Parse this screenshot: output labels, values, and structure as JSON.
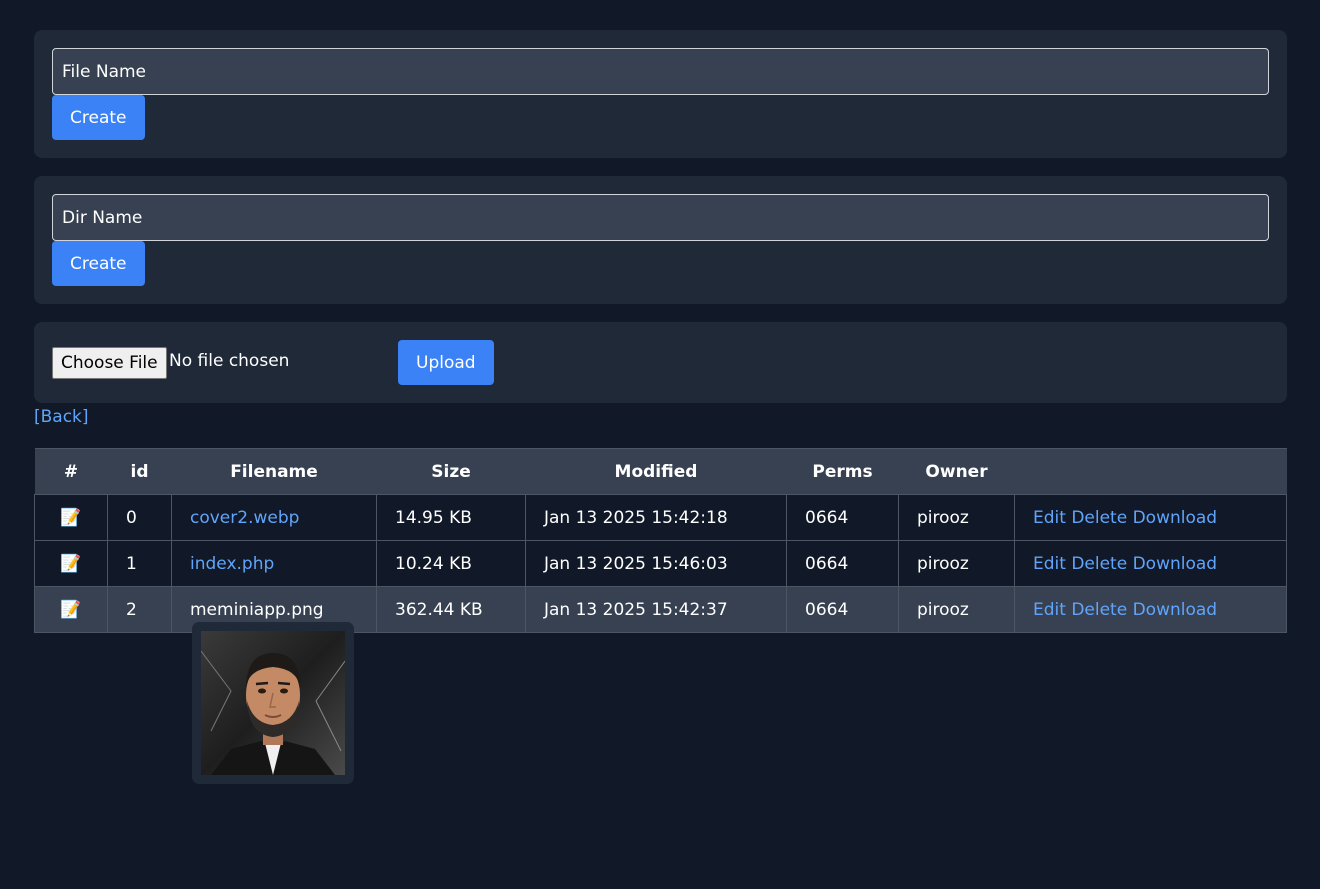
{
  "file_form": {
    "placeholder": "File Name",
    "button_label": "Create"
  },
  "dir_form": {
    "placeholder": "Dir Name",
    "button_label": "Create"
  },
  "upload_form": {
    "choose_label": "Choose File",
    "no_file_text": "No file chosen",
    "button_label": "Upload"
  },
  "back_link": "[Back]",
  "table": {
    "headers": [
      "#",
      "id",
      "Filename",
      "Size",
      "Modified",
      "Perms",
      "Owner",
      ""
    ],
    "rows": [
      {
        "icon": "📝",
        "id": "0",
        "filename": "cover2.webp",
        "size": "14.95 KB",
        "modified": "Jan 13 2025 15:42:18",
        "perms": "0664",
        "owner": "pirooz"
      },
      {
        "icon": "📝",
        "id": "1",
        "filename": "index.php",
        "size": "10.24 KB",
        "modified": "Jan 13 2025 15:46:03",
        "perms": "0664",
        "owner": "pirooz"
      },
      {
        "icon": "📝",
        "id": "2",
        "filename": "meminiapp.png",
        "size": "362.44 KB",
        "modified": "Jan 13 2025 15:42:37",
        "perms": "0664",
        "owner": "pirooz"
      }
    ],
    "actions": {
      "edit": "Edit",
      "delete": "Delete",
      "download": "Download"
    }
  },
  "colors": {
    "background": "#111827",
    "panel": "#1f2937",
    "input": "#374151",
    "accent": "#3b82f6",
    "link": "#60a5fa"
  }
}
